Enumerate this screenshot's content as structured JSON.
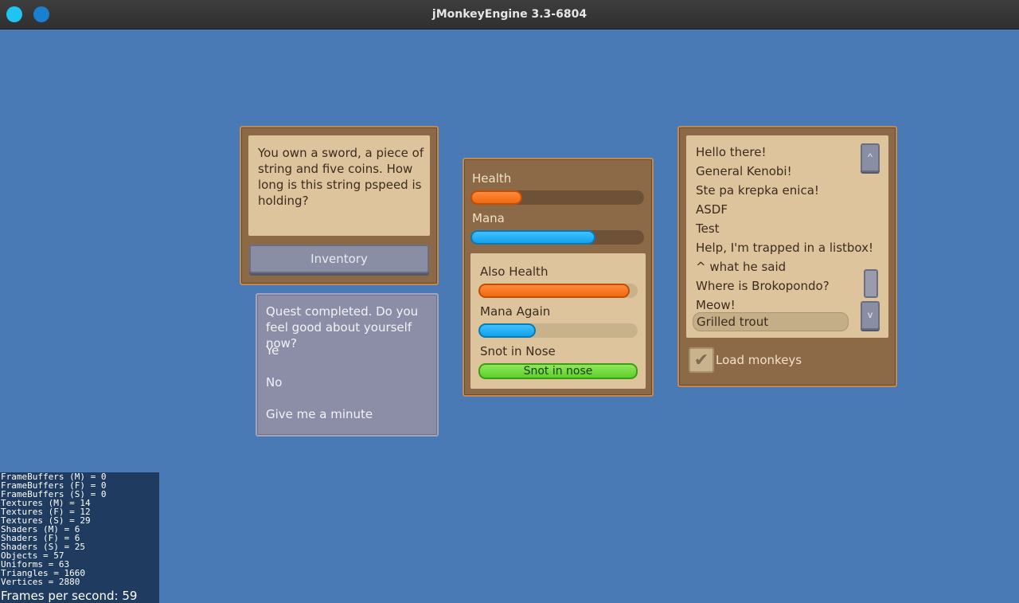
{
  "window": {
    "title": "jMonkeyEngine 3.3-6804"
  },
  "dialog": {
    "text": "You own a sword, a piece of string and five coins. How long is this string pspeed is holding?",
    "button": "Inventory"
  },
  "quest": {
    "text": "Quest completed. Do you feel good about yourself now?",
    "options": [
      "Ye",
      "No",
      "Give me a minute"
    ]
  },
  "bars": {
    "health": {
      "label": "Health",
      "value": 0.3
    },
    "mana": {
      "label": "Mana",
      "value": 0.72
    },
    "also_health": {
      "label": "Also Health",
      "value": 0.95
    },
    "mana_again": {
      "label": "Mana Again",
      "value": 0.36
    },
    "snot": {
      "label": "Snot in Nose",
      "text": "Snot in nose",
      "value": 1.0
    }
  },
  "list": {
    "items": [
      "Hello there!",
      "General Kenobi!",
      "Ste pa krepka enica!",
      "ASDF",
      "Test",
      "Help, I'm trapped in a listbox!",
      "^ what he said",
      "Where is Brokopondo?",
      "Meow!",
      "Grilled trout"
    ],
    "selected": "Grilled trout",
    "scroll_up": "^",
    "scroll_down": "v",
    "checkbox_label": "Load monkeys",
    "checkbox_checked": true
  },
  "stats": {
    "lines": [
      "FrameBuffers (M) = 0",
      "FrameBuffers (F) = 0",
      "FrameBuffers (S) = 0",
      "Textures (M) = 14",
      "Textures (F) = 12",
      "Textures (S) = 29",
      "Shaders (M) = 6",
      "Shaders (F) = 6",
      "Shaders (S) = 25",
      "Objects = 57",
      "Uniforms = 63",
      "Triangles = 1660",
      "Vertices = 2880"
    ],
    "fps": "Frames per second: 59"
  },
  "colors": {
    "background": "#4a7ab6",
    "panel": "#8c6a48",
    "parchment": "#dec49c"
  }
}
